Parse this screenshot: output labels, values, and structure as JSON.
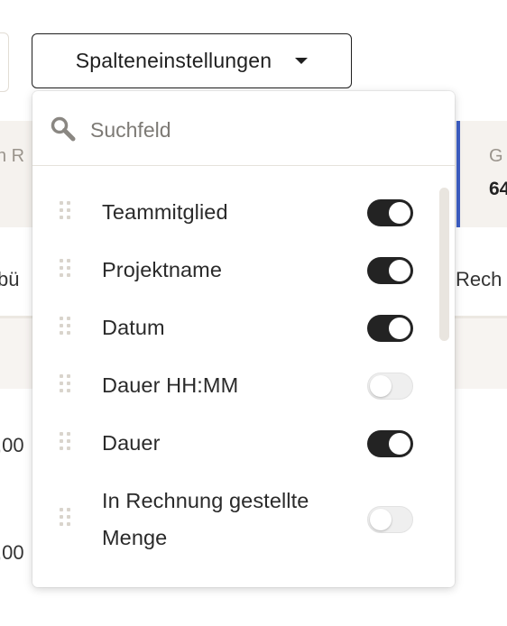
{
  "background": {
    "left_col_text_1": "n R",
    "left_col_text_2": "bü",
    "left_val_1": ",00",
    "left_val_2": ",00",
    "right_label": "G",
    "right_value": "64",
    "right_col_text": "Rech"
  },
  "column_settings": {
    "button_label": "Spalteneinstellungen",
    "search": {
      "placeholder": "Suchfeld",
      "value": ""
    },
    "items": [
      {
        "label": "Teammitglied",
        "enabled": true
      },
      {
        "label": "Projektname",
        "enabled": true
      },
      {
        "label": "Datum",
        "enabled": true
      },
      {
        "label": "Dauer HH:MM",
        "enabled": false
      },
      {
        "label": "Dauer",
        "enabled": true
      },
      {
        "label": "In Rechnung gestellte Menge",
        "enabled": false
      }
    ]
  },
  "colors": {
    "toggle_on": "#232323",
    "toggle_off": "#efefef",
    "accent_bar": "#3d5fc4",
    "band_bg": "#f5f2ee"
  },
  "icons": {
    "search": "search-icon",
    "drag": "drag-handle-icon",
    "caret": "caret-down-icon"
  }
}
